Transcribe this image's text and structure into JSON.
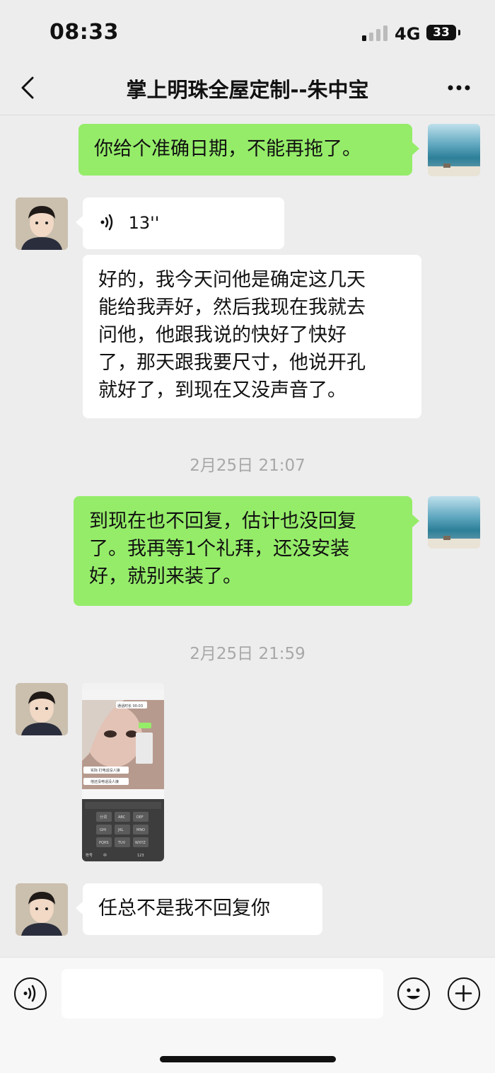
{
  "status_bar": {
    "time": "08:33",
    "network": "4G",
    "battery": "33"
  },
  "header": {
    "title": "掌上明珠全屋定制--朱中宝"
  },
  "messages": {
    "m1": "你给个准确日期，不能再拖了。",
    "voice_duration": "13''",
    "m3_lines": [
      "好的，我今天问他是确定这几天",
      "能给我弄好，然后我现在我就去",
      "问他，他跟我说的快好了快好",
      "了，那天跟我要尺寸，他说开孔",
      "就好了，到现在又没声音了。"
    ],
    "ts1": "2月25日 21:07",
    "m4_lines": [
      "到现在也不回复，估计也没回复",
      "了。我再等1个礼拜，还没安装",
      "好，就别来装了。"
    ],
    "ts2": "2月25日 21:59",
    "m6": "任总不是我不回复你"
  },
  "thumbnail": {
    "call_label": "通话时长 00:03",
    "bubble1": "实际  打电话没人接",
    "bubble2": "他还没电话没人接",
    "keys_row1": [
      "分词",
      "ABC",
      "DEF"
    ],
    "keys_row2": [
      "GHI",
      "JKL",
      "MNO"
    ],
    "keys_row3": [
      "PQRS",
      "TUV",
      "WXYZ"
    ],
    "keys_row4": [
      "符号",
      "中",
      "123"
    ]
  },
  "icons": [
    "back-arrow-icon",
    "more-dots-icon",
    "voice-wave-icon",
    "voice-input-icon",
    "emoji-icon",
    "add-icon"
  ],
  "colors": {
    "self_bubble": "#95ec69",
    "other_bubble": "#ffffff",
    "background": "#ededed"
  }
}
